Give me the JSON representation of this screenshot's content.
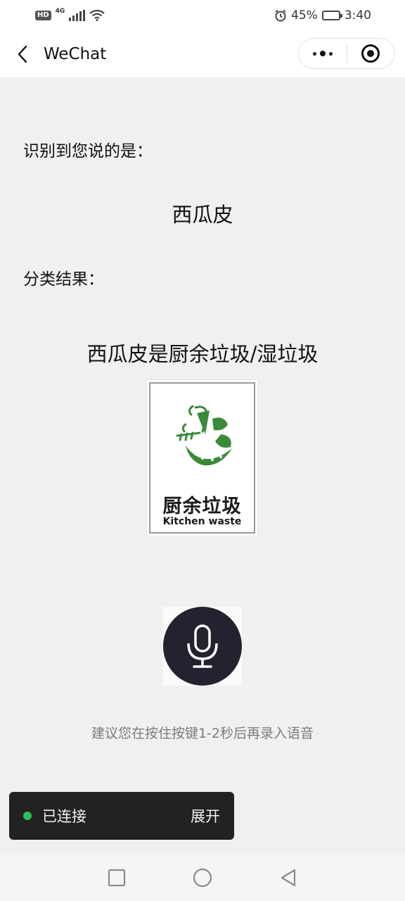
{
  "status_bar": {
    "hd_badge": "HD",
    "network": "4G",
    "alarm_icon": "alarm-icon",
    "battery_percent": "45%",
    "battery_level": 0.45,
    "time": "3:40"
  },
  "nav": {
    "back_icon": "chevron-left-icon",
    "title": "WeChat",
    "menu_icon": "more-dots-icon",
    "close_icon": "target-circle-icon"
  },
  "content": {
    "recognized_label": "识别到您说的是：",
    "recognized_text": "西瓜皮",
    "result_label": "分类结果：",
    "result_text": "西瓜皮是厨余垃圾/湿垃圾",
    "waste_card": {
      "icon": "kitchen-waste-icon",
      "title_cn": "厨余垃圾",
      "title_en": "Kitchen waste",
      "accent_color": "#3a8a3a"
    },
    "mic_icon": "microphone-icon",
    "hint": "建议您在按住按键1-2秒后再录入语音"
  },
  "toast": {
    "status_color": "#2fbf5a",
    "text": "已连接",
    "action": "展开"
  },
  "system_nav": {
    "recent_icon": "square-icon",
    "home_icon": "circle-icon",
    "back_icon": "triangle-back-icon"
  }
}
